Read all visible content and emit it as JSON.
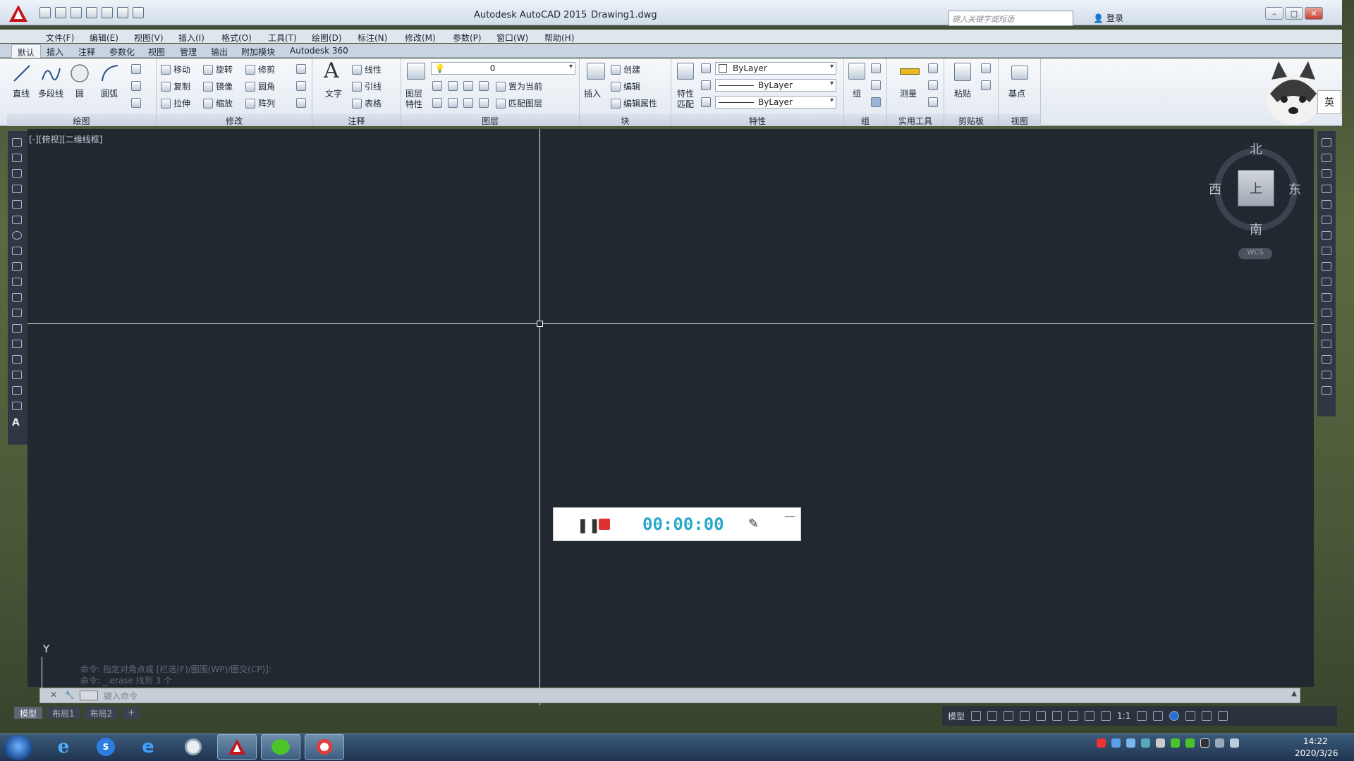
{
  "window": {
    "app_title": "Autodesk AutoCAD 2015",
    "file_name": "Drawing1.dwg"
  },
  "search": {
    "placeholder": "键入关键字或短语"
  },
  "login": {
    "label": "登录"
  },
  "menu": [
    "文件(F)",
    "编辑(E)",
    "视图(V)",
    "插入(I)",
    "格式(O)",
    "工具(T)",
    "绘图(D)",
    "标注(N)",
    "修改(M)",
    "参数(P)",
    "窗口(W)",
    "帮助(H)"
  ],
  "ribbon_tabs": [
    "默认",
    "插入",
    "注释",
    "参数化",
    "视图",
    "管理",
    "输出",
    "附加模块",
    "Autodesk 360"
  ],
  "ribbon": {
    "draw": {
      "title": "绘图",
      "line": "直线",
      "polyline": "多段线",
      "circle": "圆",
      "arc": "圆弧"
    },
    "modify": {
      "title": "修改",
      "move": "移动",
      "rotate": "旋转",
      "trim": "修剪",
      "copy": "复制",
      "mirror": "镜像",
      "fillet": "圆角",
      "stretch": "拉伸",
      "scale": "缩放",
      "array": "阵列"
    },
    "annotation": {
      "title": "注释",
      "text": "文字",
      "linear": "线性",
      "leader": "引线",
      "table": "表格"
    },
    "layers": {
      "title": "图层",
      "properties_line1": "图层",
      "properties_line2": "特性",
      "layer_value": "0",
      "set_current": "置为当前",
      "match_layer": "匹配图层"
    },
    "block": {
      "title": "块",
      "insert": "插入",
      "create": "创建",
      "edit": "编辑",
      "edit_attr": "编辑属性"
    },
    "properties": {
      "title": "特性",
      "match_line1": "特性",
      "match_line2": "匹配",
      "color": "ByLayer",
      "linetype": "ByLayer",
      "lineweight": "ByLayer"
    },
    "groups": {
      "title": "组",
      "group": "组"
    },
    "utilities": {
      "title": "实用工具",
      "measure": "测量"
    },
    "clipboard": {
      "title": "剪贴板",
      "paste": "粘贴"
    },
    "view": {
      "title": "视图",
      "base": "基点"
    }
  },
  "viewport": {
    "label": "[-][俯视][二维线框]"
  },
  "viewcube": {
    "north": "北",
    "south": "南",
    "east": "东",
    "west": "西",
    "face": "上",
    "wcs": "WCS"
  },
  "ime": {
    "label": "英"
  },
  "recorder": {
    "time": "00:00:00"
  },
  "ucs": {
    "y_label": "Y"
  },
  "command": {
    "history": [
      "命令: 指定对角点或 [栏选(F)/圈围(WP)/圈交(CP)]:",
      "命令: _.erase 找到 3 个"
    ],
    "placeholder": "键入命令"
  },
  "layout_tabs": [
    "模型",
    "布局1",
    "布局2"
  ],
  "status": {
    "model": "模型",
    "scale": "1:1"
  },
  "clock": {
    "time": "14:22",
    "date": "2020/3/26"
  }
}
